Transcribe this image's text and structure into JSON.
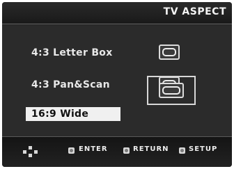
{
  "header": {
    "title": "TV ASPECT"
  },
  "options": [
    {
      "label": "4:3 Letter Box",
      "icon": "tv-4-3-icon"
    },
    {
      "label": "4:3 Pan&Scan",
      "icon": "tv-4-3-icon"
    },
    {
      "label": "16:9 Wide",
      "icon": "tv-16-9-icon",
      "selected": true
    }
  ],
  "footer": {
    "nav_icon": "dpad-icon",
    "enter_label": "ENTER",
    "return_label": "RETURN",
    "setup_label": "SETUP"
  },
  "colors": {
    "background": "#1e1e1e",
    "highlight": "#f0f0f0",
    "text": "#e8e8e8"
  }
}
